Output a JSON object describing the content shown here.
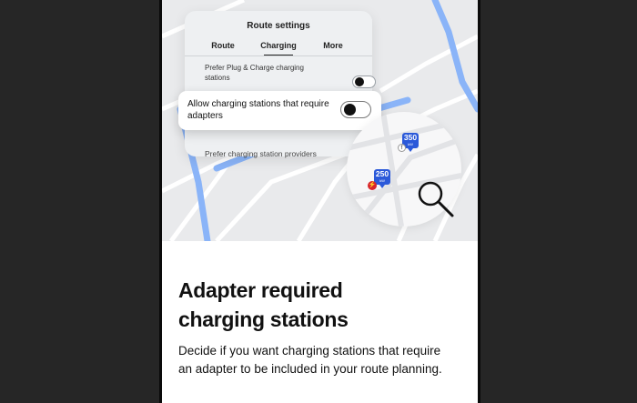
{
  "colors": {
    "background": "#262626",
    "card": "#ffffff",
    "map_base": "#e9eaec",
    "route_blue": "#8ab4f8",
    "pin_blue": "#2b59d9",
    "alert_red": "#d8252d"
  },
  "settings_panel": {
    "title": "Route settings",
    "tabs": [
      {
        "label": "Route",
        "active": false
      },
      {
        "label": "Charging",
        "active": true
      },
      {
        "label": "More",
        "active": false
      }
    ],
    "prefer_plug_charge": {
      "label": "Prefer Plug & Charge charging stations",
      "toggle_on": false
    },
    "allow_adapters": {
      "label": "Allow charging stations that require adapters",
      "toggle_on": false
    },
    "prefer_providers": {
      "label": "Prefer charging station providers",
      "chevron": "chevron-right-icon"
    }
  },
  "map": {
    "pins": [
      {
        "value": "350",
        "unit": "kW"
      },
      {
        "value": "250",
        "unit": "kW"
      }
    ],
    "icons": [
      "search-icon",
      "lightning-icon"
    ]
  },
  "content": {
    "headline_lines": [
      "Adapter required",
      "charging stations"
    ],
    "description_lines": [
      "Decide if you want charging stations that require",
      "an adapter to be included in your route planning."
    ]
  }
}
